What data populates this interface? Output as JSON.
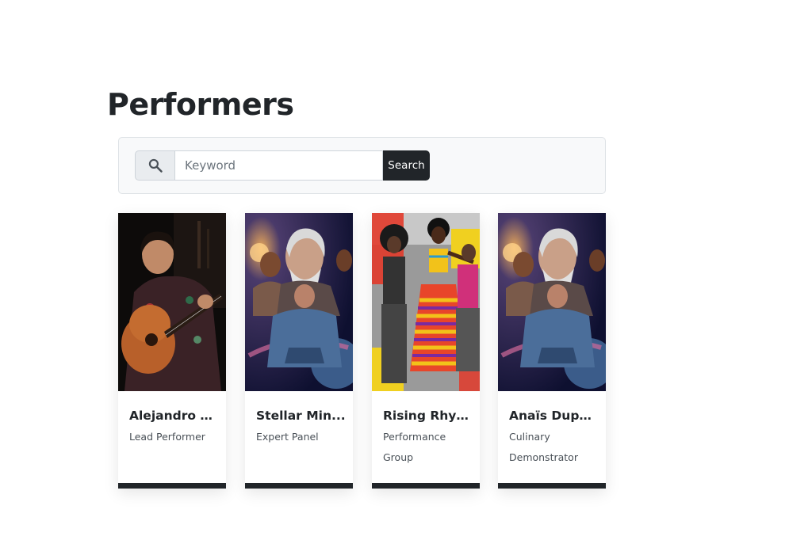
{
  "page": {
    "title": "Performers"
  },
  "search": {
    "placeholder": "Keyword",
    "button_label": "Search"
  },
  "performers": [
    {
      "name": "Alejandro C...",
      "role": "Lead Performer",
      "image": "guitarist-photo"
    },
    {
      "name": "Stellar Min...",
      "role": "Expert Panel",
      "image": "cosmic-panel-collage"
    },
    {
      "name": "Rising Rhyt...",
      "role": "Performance Group",
      "image": "dancers-collage"
    },
    {
      "name": "Anaïs Dupont",
      "role": "Culinary Demonstrator",
      "image": "cosmic-panel-collage"
    }
  ]
}
